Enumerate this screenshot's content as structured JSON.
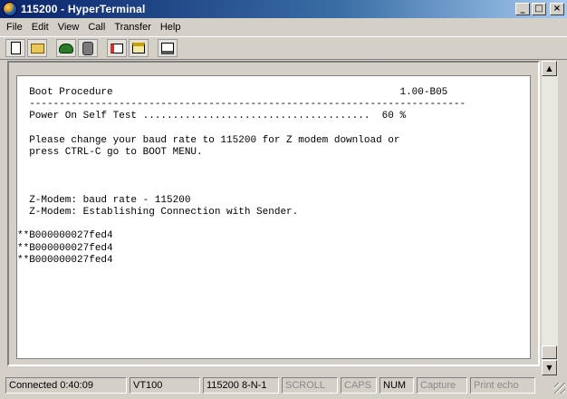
{
  "window": {
    "title": "115200 - HyperTerminal",
    "minimize_glyph": "_",
    "maximize_glyph": "□",
    "close_glyph": "×"
  },
  "menu": {
    "items": [
      "File",
      "Edit",
      "View",
      "Call",
      "Transfer",
      "Help"
    ]
  },
  "toolbar": {
    "icons": [
      "new-connection-icon",
      "open-icon",
      "connect-phone-icon",
      "disconnect-icon",
      "send-file-icon",
      "receive-file-icon",
      "properties-icon"
    ]
  },
  "terminal": {
    "lines": [
      "  Boot Procedure                                                1.00-B05",
      "  -------------------------------------------------------------------------",
      "  Power On Self Test ......................................  60 %",
      "",
      "  Please change your baud rate to 115200 for Z modem download or",
      "  press CTRL-C go to BOOT MENU.",
      "",
      "",
      "",
      "  Z-Modem: baud rate - 115200",
      "  Z-Modem: Establishing Connection with Sender.",
      "",
      "**B000000027fed4",
      "**B000000027fed4",
      "**B000000027fed4"
    ]
  },
  "scrollbar": {
    "up_glyph": "▲",
    "down_glyph": "▼"
  },
  "status": {
    "connected": "Connected 0:40:09",
    "emulation": "VT100",
    "settings": "115200 8-N-1",
    "scroll": "SCROLL",
    "caps": "CAPS",
    "num": "NUM",
    "capture": "Capture",
    "print_echo": "Print echo"
  }
}
